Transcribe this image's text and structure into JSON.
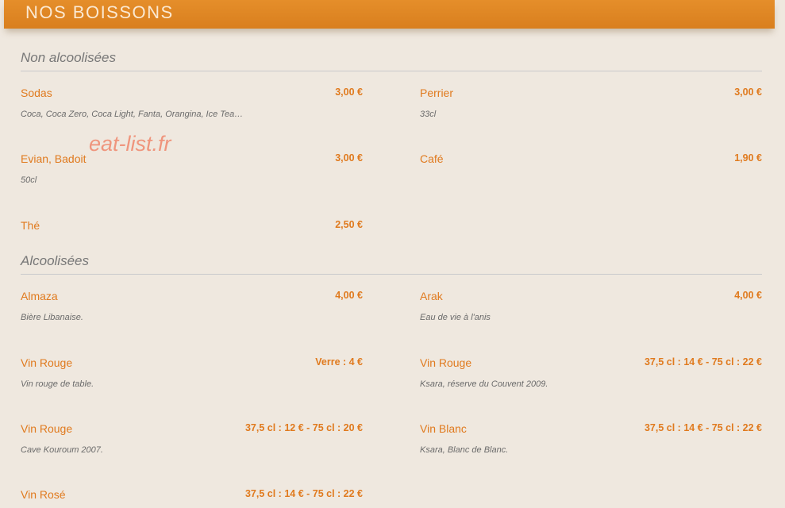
{
  "header": {
    "title": "NOS BOISSONS"
  },
  "watermark": "eat-list.fr",
  "sections": [
    {
      "title": "Non alcoolisées",
      "items": [
        {
          "name": "Sodas",
          "price": "3,00 €",
          "desc": "Coca, Coca Zero, Coca Light, Fanta, Orangina, Ice Tea…"
        },
        {
          "name": "Perrier",
          "price": "3,00 €",
          "desc": "33cl"
        },
        {
          "name": "Evian, Badoit",
          "price": "3,00 €",
          "desc": "50cl"
        },
        {
          "name": "Café",
          "price": "1,90 €",
          "desc": ""
        },
        {
          "name": "Thé",
          "price": "2,50 €",
          "desc": ""
        }
      ]
    },
    {
      "title": "Alcoolisées",
      "items": [
        {
          "name": "Almaza",
          "price": "4,00 €",
          "desc": "Bière Libanaise."
        },
        {
          "name": "Arak",
          "price": "4,00 €",
          "desc": "Eau de vie à l'anis"
        },
        {
          "name": "Vin Rouge",
          "price": "Verre : 4 €",
          "desc": "Vin rouge de table."
        },
        {
          "name": "Vin Rouge",
          "price": "37,5 cl : 14 € - 75 cl : 22 €",
          "desc": "Ksara, réserve du Couvent 2009."
        },
        {
          "name": "Vin Rouge",
          "price": "37,5 cl : 12 € - 75 cl : 20 €",
          "desc": "Cave Kouroum 2007."
        },
        {
          "name": "Vin Blanc",
          "price": "37,5 cl : 14 € - 75 cl : 22 €",
          "desc": "Ksara, Blanc de Blanc."
        },
        {
          "name": "Vin Rosé",
          "price": "37,5 cl : 14 € - 75 cl : 22 €",
          "desc": ""
        }
      ]
    }
  ]
}
